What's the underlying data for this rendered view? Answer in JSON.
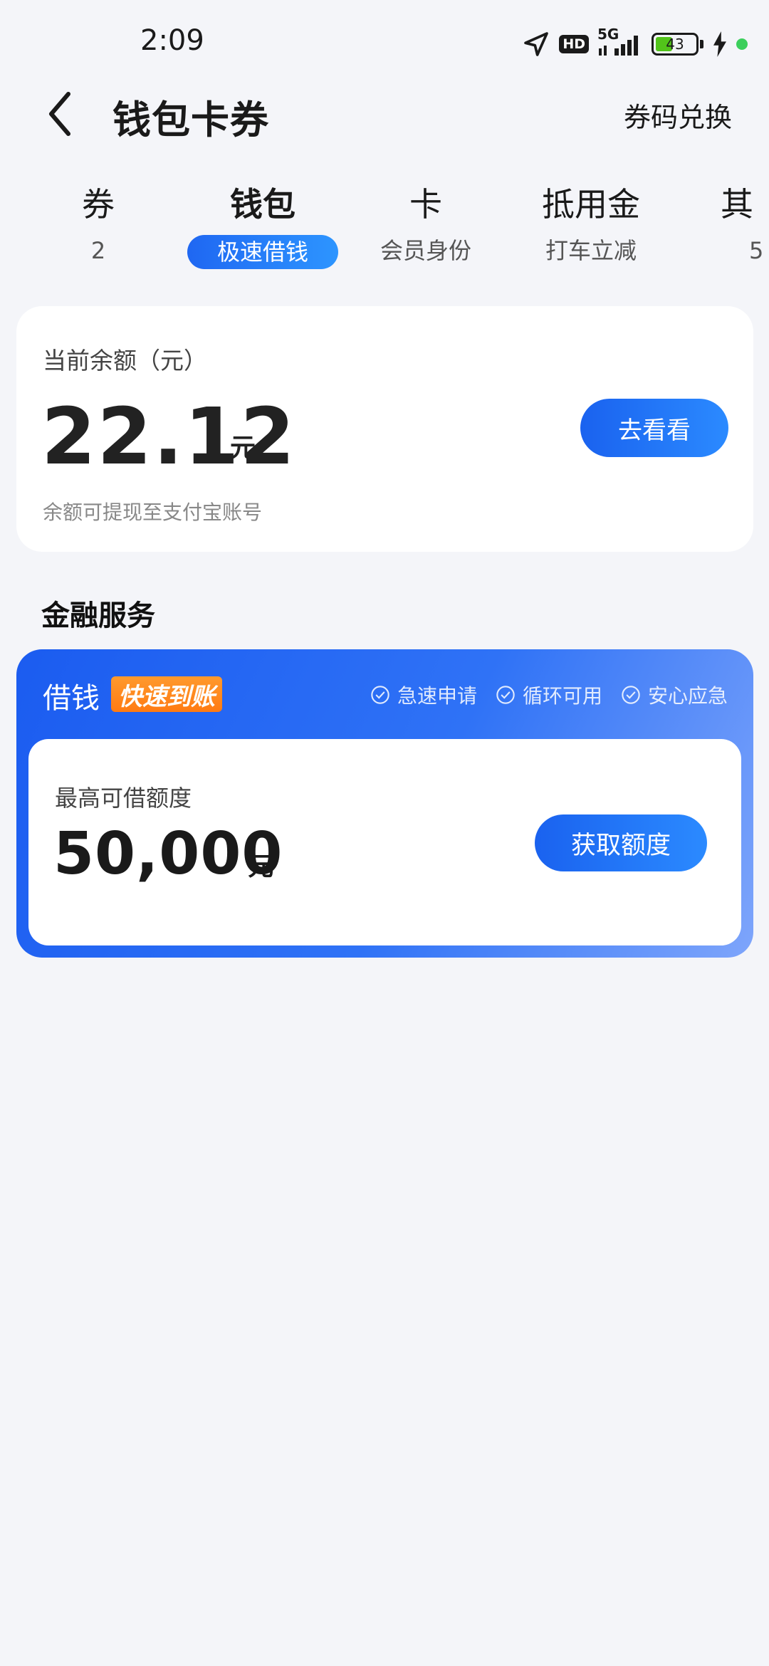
{
  "status_bar": {
    "time": "2:09",
    "hd_label": "HD",
    "network_label": "5G",
    "battery_level": "43",
    "icons": [
      "location-arrow-icon",
      "hd-icon",
      "signal-icon",
      "battery-icon",
      "charging-icon"
    ]
  },
  "header": {
    "title": "钱包卡券",
    "right_link": "券码兑换",
    "back_icon": "chevron-left-icon"
  },
  "tabs": [
    {
      "label": "券",
      "sub": "2",
      "active": false
    },
    {
      "label": "钱包",
      "sub": "极速借钱",
      "active": true
    },
    {
      "label": "卡",
      "sub": "会员身份",
      "active": false
    },
    {
      "label": "抵用金",
      "sub": "打车立减",
      "active": false
    },
    {
      "label": "其",
      "sub": "5",
      "active": false
    }
  ],
  "balance": {
    "label": "当前余额（元）",
    "amount": "22.12",
    "unit": "元",
    "note": "余额可提现至支付宝账号",
    "button": "去看看"
  },
  "finance": {
    "section_title": "金融服务",
    "card_title": "借钱",
    "tag": "快速到账",
    "features": [
      "急速申请",
      "循环可用",
      "安心应急"
    ],
    "limit_label": "最高可借额度",
    "limit_amount": "50,000",
    "limit_unit": "元",
    "button": "获取额度"
  },
  "colors": {
    "accent": "#1f67f2",
    "tag_orange": "#ff8a1f",
    "background": "#f4f5f9"
  }
}
